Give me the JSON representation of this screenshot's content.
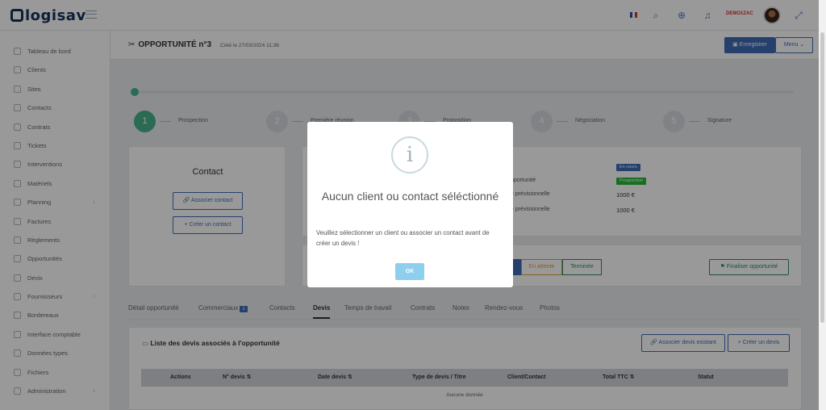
{
  "topbar": {
    "logo": "logisav",
    "user": "DEMO1ZAC"
  },
  "sidebar": {
    "items": [
      {
        "label": "Tableau de bord",
        "icon": "dashboard-icon",
        "chev": false
      },
      {
        "label": "Clients",
        "icon": "clients-icon",
        "chev": false
      },
      {
        "label": "Sites",
        "icon": "sites-icon",
        "chev": false
      },
      {
        "label": "Contacts",
        "icon": "contacts-icon",
        "chev": false
      },
      {
        "label": "Contrats",
        "icon": "contracts-icon",
        "chev": false
      },
      {
        "label": "Tickets",
        "icon": "tickets-icon",
        "chev": false
      },
      {
        "label": "Interventions",
        "icon": "wrench-icon",
        "chev": false
      },
      {
        "label": "Matériels",
        "icon": "equipment-icon",
        "chev": false
      },
      {
        "label": "Planning",
        "icon": "calendar-icon",
        "chev": true
      },
      {
        "label": "Factures",
        "icon": "invoice-icon",
        "chev": false
      },
      {
        "label": "Règlements",
        "icon": "payment-icon",
        "chev": false
      },
      {
        "label": "Opportunités",
        "icon": "opportunity-icon",
        "chev": false
      },
      {
        "label": "Devis",
        "icon": "quote-icon",
        "chev": false
      },
      {
        "label": "Fournisseurs",
        "icon": "supplier-icon",
        "chev": true
      },
      {
        "label": "Bordereaux",
        "icon": "slip-icon",
        "chev": false
      },
      {
        "label": "Interface comptable",
        "icon": "accounting-icon",
        "chev": false
      },
      {
        "label": "Données types",
        "icon": "data-types-icon",
        "chev": false
      },
      {
        "label": "Fichiers",
        "icon": "files-icon",
        "chev": false
      },
      {
        "label": "Administration",
        "icon": "admin-icon",
        "chev": true
      }
    ]
  },
  "header": {
    "title": "OPPORTUNITÉ n°3",
    "created": "Créé le 27/03/2024 11:36",
    "save": "Enregistrer",
    "menu": "Menu"
  },
  "steps": [
    {
      "num": "1",
      "label": "Prospection"
    },
    {
      "num": "2",
      "label": "Première réunion"
    },
    {
      "num": "3",
      "label": "Proposition"
    },
    {
      "num": "4",
      "label": "Négociation"
    },
    {
      "num": "5",
      "label": "Signature"
    }
  ],
  "contact": {
    "title": "Contact",
    "associate": "Associer contact",
    "create": "Créer un contact"
  },
  "info": {
    "status_badge": "En cours",
    "stage_badge": "Prospection",
    "stage_label": "pportunité",
    "amount_label": "e prévisionnelle",
    "amount_value": "1000 €",
    "margin_label": "e prévisionnelle",
    "margin_value": "1000 €"
  },
  "status_buttons": {
    "waiting": "En attente",
    "done": "Terminée",
    "finalize": "Finaliser opportunité"
  },
  "tabs": [
    {
      "label": "Détail opportunité",
      "count": ""
    },
    {
      "label": "Commerciaux",
      "count": "1"
    },
    {
      "label": "Contacts",
      "count": ""
    },
    {
      "label": "Devis",
      "count": ""
    },
    {
      "label": "Temps de travail",
      "count": ""
    },
    {
      "label": "Contrats",
      "count": ""
    },
    {
      "label": "Notes",
      "count": ""
    },
    {
      "label": "Rendez-vous",
      "count": ""
    },
    {
      "label": "Photos",
      "count": ""
    }
  ],
  "quotes": {
    "title": "Liste des devis associés à l'opportunité",
    "associate": "Associer devis existant",
    "create": "Créer un devis",
    "columns": [
      "Actions",
      "N° devis ⇅",
      "Date devis ⇅",
      "Type de devis / Titre",
      "Client/Contact",
      "Total TTC ⇅",
      "Statut"
    ],
    "empty": "Aucune donnée"
  },
  "modal": {
    "icon": "i",
    "title": "Aucun client ou contact séléctionné",
    "text": "Veuillez sélectionner un client ou associer un contact avant de créer un devis !",
    "ok": "OK"
  },
  "colors": {
    "primary": "#3f6bb5",
    "success": "#49b38a",
    "ok_button": "#8fcfee"
  }
}
